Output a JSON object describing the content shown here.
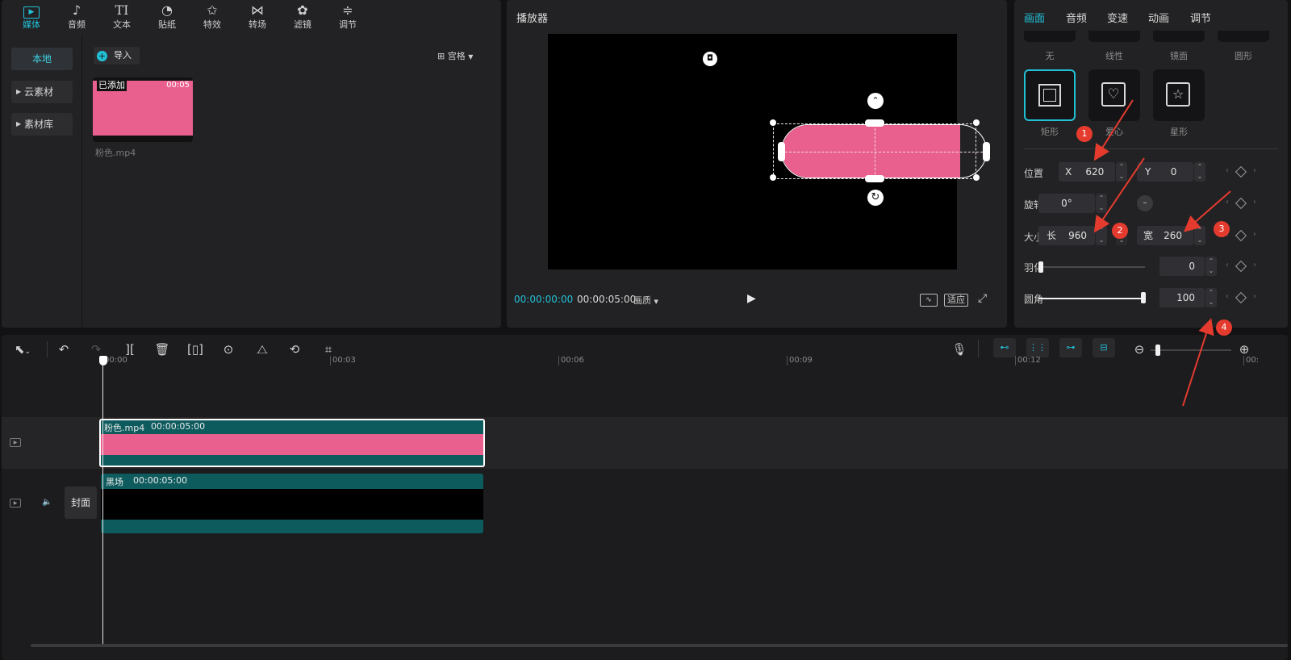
{
  "media": {
    "tools": [
      {
        "label": "媒体",
        "icon": "media-icon",
        "glyph": "▶"
      },
      {
        "label": "音频",
        "icon": "audio-icon",
        "glyph": "♪"
      },
      {
        "label": "文本",
        "icon": "text-icon",
        "glyph": "TI"
      },
      {
        "label": "贴纸",
        "icon": "sticker-icon",
        "glyph": "◔"
      },
      {
        "label": "特效",
        "icon": "effects-icon",
        "glyph": "✩"
      },
      {
        "label": "转场",
        "icon": "transition-icon",
        "glyph": "⋈"
      },
      {
        "label": "滤镜",
        "icon": "filter-icon",
        "glyph": "✿"
      },
      {
        "label": "调节",
        "icon": "adjust-icon",
        "glyph": "≑"
      }
    ],
    "sidebar": [
      {
        "label": "本地"
      },
      {
        "label": "云素材"
      },
      {
        "label": "素材库"
      }
    ],
    "import_label": "导入",
    "view_label": "宫格",
    "clip": {
      "added_label": "已添加",
      "duration": "00:05",
      "name": "粉色.mp4",
      "color": "#e9608f"
    }
  },
  "player": {
    "title": "播放器",
    "time_current": "00:00:00:00",
    "time_total": "00:00:05:00",
    "quality_label": "画质",
    "fit_label": "适应"
  },
  "props": {
    "tabs": [
      "画面",
      "音频",
      "变速",
      "动画",
      "调节"
    ],
    "top_shape_labels": [
      "无",
      "线性",
      "镜面",
      "圆形"
    ],
    "shapes": [
      {
        "label": "矩形",
        "icon": "rectangle-mask-icon"
      },
      {
        "label": "爱心",
        "icon": "heart-mask-icon"
      },
      {
        "label": "星形",
        "icon": "star-mask-icon"
      }
    ],
    "position": {
      "label": "位置",
      "x_label": "X",
      "x": "620",
      "y_label": "Y",
      "y": "0"
    },
    "rotation": {
      "label": "旋转",
      "value": "0°"
    },
    "size": {
      "label": "大小",
      "length_label": "长",
      "length": "960",
      "width_label": "宽",
      "width": "260"
    },
    "feather": {
      "label": "羽化",
      "value": "0",
      "level": 0
    },
    "corner": {
      "label": "圆角",
      "value": "100",
      "level": 1
    }
  },
  "timeline": {
    "ticks": [
      "00:00",
      "00:03",
      "00:06",
      "00:09",
      "00:12",
      "00:"
    ],
    "track1": {
      "name": "粉色.mp4",
      "duration": "00:00:05:00"
    },
    "track2": {
      "name": "黑场",
      "duration": "00:00:05:00"
    },
    "cover_label": "封面"
  },
  "annotations": [
    "1",
    "2",
    "3",
    "4"
  ],
  "colors": {
    "accent": "#22c0d6",
    "clip_pink": "#e9608f",
    "track_teal": "#0e5b5e",
    "arrow_red": "#e53b2f"
  }
}
